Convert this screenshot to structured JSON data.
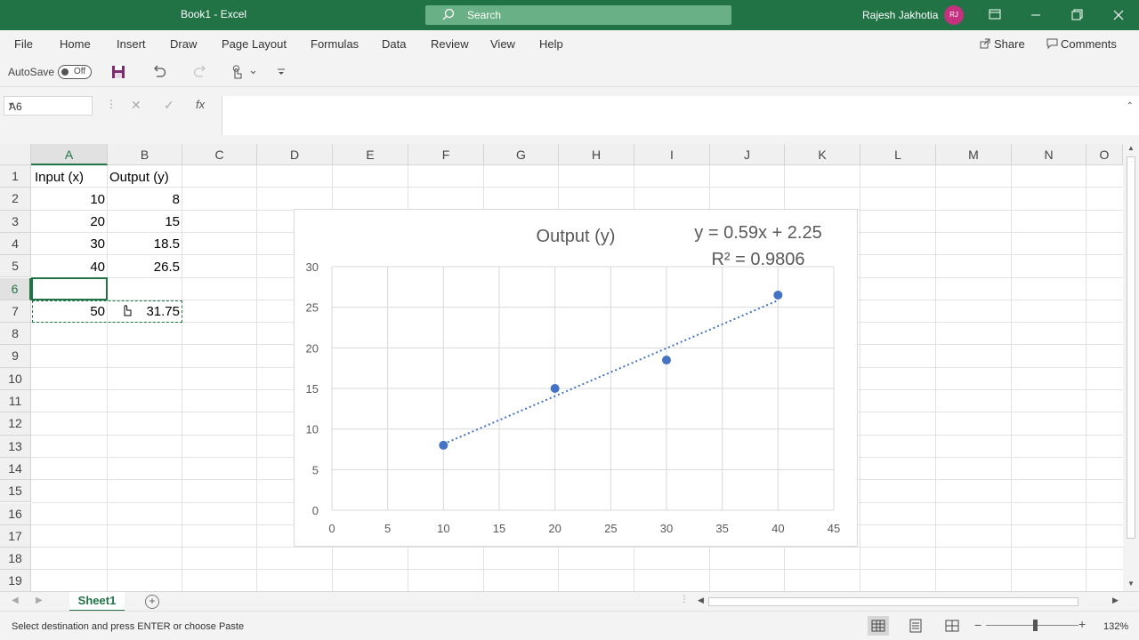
{
  "window": {
    "title": "Book1  -  Excel",
    "search_placeholder": "Search",
    "user_name": "Rajesh Jakhotia",
    "user_initials": "RJ"
  },
  "ribbon": {
    "tabs": [
      "File",
      "Home",
      "Insert",
      "Draw",
      "Page Layout",
      "Formulas",
      "Data",
      "Review",
      "View",
      "Help"
    ],
    "share_label": "Share",
    "comments_label": "Comments"
  },
  "qat": {
    "autosave_label": "AutoSave",
    "autosave_state": "Off"
  },
  "formula_bar": {
    "name_box": "A6",
    "fx_label": "fx",
    "formula": ""
  },
  "grid": {
    "columns": [
      "A",
      "B",
      "C",
      "D",
      "E",
      "F",
      "G",
      "H",
      "I",
      "J",
      "K",
      "L",
      "M",
      "N",
      "O"
    ],
    "rows": [
      "1",
      "2",
      "3",
      "4",
      "5",
      "6",
      "7",
      "8",
      "9",
      "10",
      "11",
      "12",
      "13",
      "14",
      "15",
      "16",
      "17",
      "18",
      "19"
    ],
    "selected_column": "A",
    "selected_row": "6",
    "cells": {
      "A1": "Input (x)",
      "B1": "Output (y)",
      "A2": "10",
      "B2": "8",
      "A3": "20",
      "B3": "15",
      "A4": "30",
      "B4": "18.5",
      "A5": "40",
      "B5": "26.5",
      "A7": "50",
      "B7": "31.75"
    }
  },
  "chart_data": {
    "type": "scatter",
    "title": "Output (y)",
    "trendline_equation": "y = 0.59x + 2.25",
    "r_squared_label": "R² = 0.9806",
    "trendline": {
      "slope": 0.59,
      "intercept": 2.25,
      "style": "dotted"
    },
    "series": [
      {
        "x": [
          10,
          20,
          30,
          40
        ],
        "y": [
          8,
          15,
          18.5,
          26.5
        ]
      }
    ],
    "xlim": [
      0,
      45
    ],
    "ylim": [
      0,
      30
    ],
    "xticks": [
      "0",
      "5",
      "10",
      "15",
      "20",
      "25",
      "30",
      "35",
      "40",
      "45"
    ],
    "yticks": [
      "0",
      "5",
      "10",
      "15",
      "20",
      "25",
      "30"
    ],
    "grid": true,
    "marker_color": "#4472c4"
  },
  "sheets": {
    "active": "Sheet1",
    "add_label": "+"
  },
  "status_bar": {
    "message": "Select destination and press ENTER or choose Paste",
    "zoom": "132%"
  }
}
